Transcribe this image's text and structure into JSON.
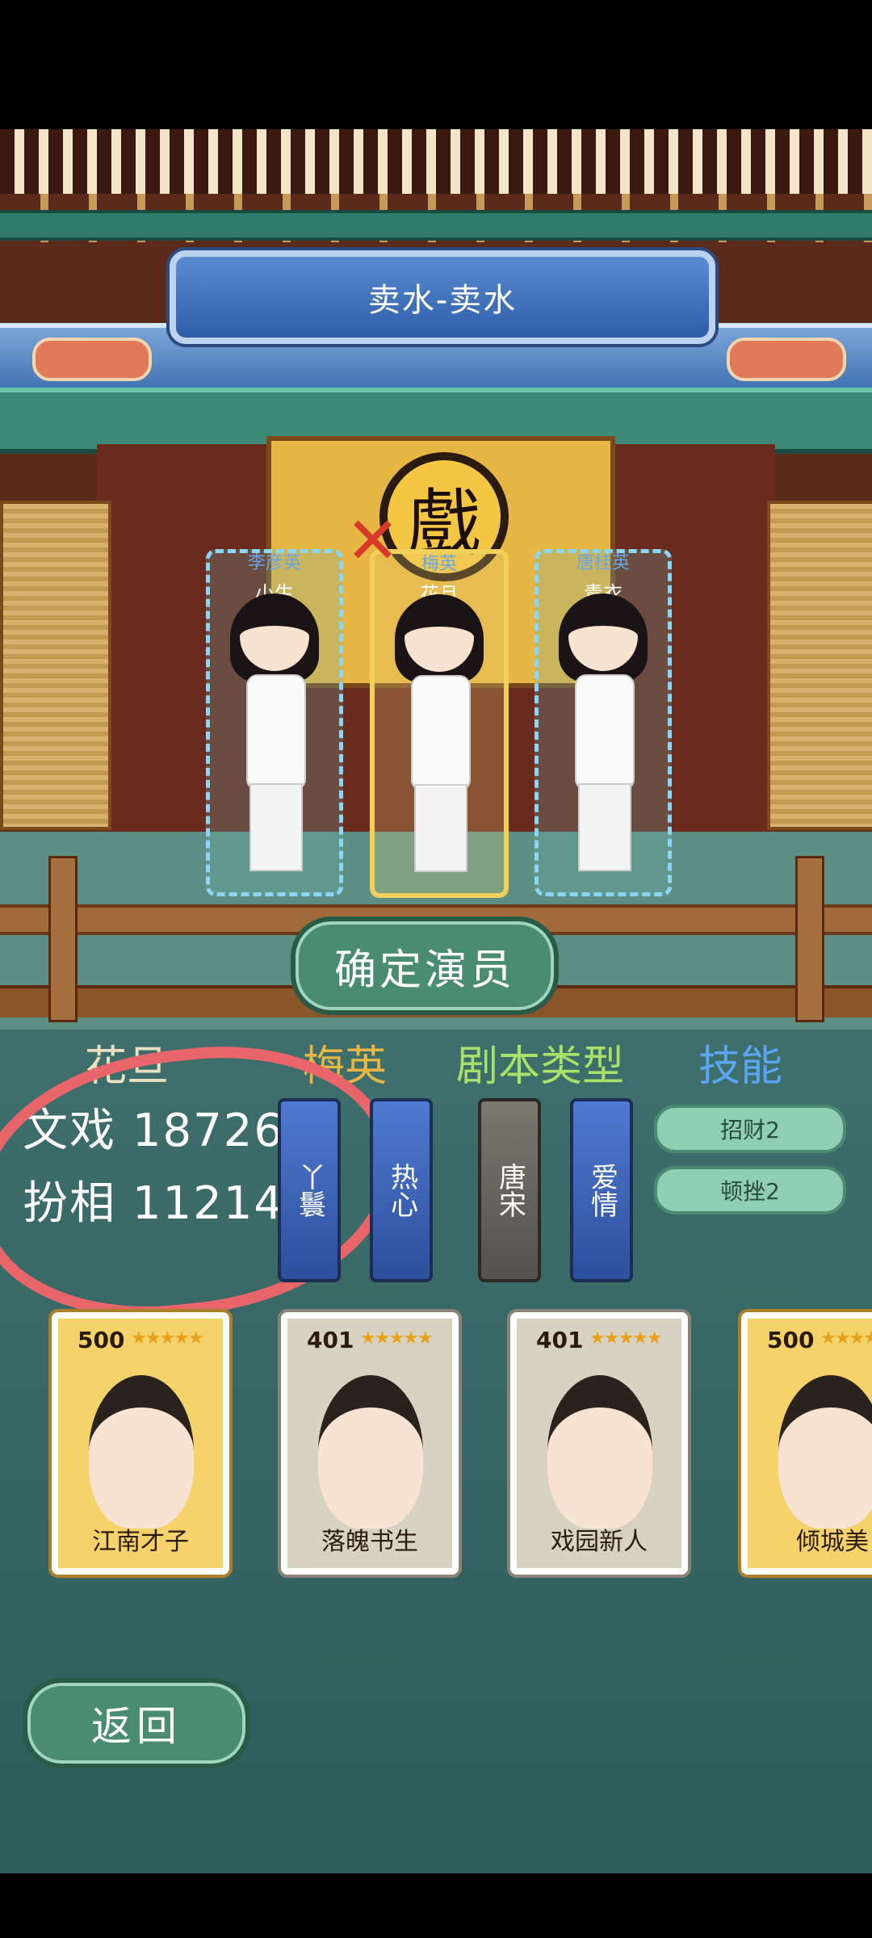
{
  "play_title": "卖水-卖水",
  "stage_emblem": "戲",
  "actors": [
    {
      "name": "李彦英",
      "role": "小生",
      "selected": false
    },
    {
      "name": "梅英",
      "role": "花旦",
      "selected": true
    },
    {
      "name": "唐桂英",
      "role": "青衣",
      "selected": false
    }
  ],
  "confirm_label": "确定演员",
  "role_header": "花旦",
  "actor_header": "梅英",
  "script_type_header": "剧本类型",
  "skills_header": "技能",
  "stats": [
    {
      "label": "文戏",
      "value": "18726"
    },
    {
      "label": "扮相",
      "value": "11214"
    }
  ],
  "actor_tags": [
    "丫鬟",
    "热心"
  ],
  "script_tags": [
    "唐宋",
    "爱情"
  ],
  "skills": [
    "招财2",
    "顿挫2"
  ],
  "cards": [
    {
      "level": "500",
      "stars": "★★★★★",
      "name": "江南才子",
      "rarity": "gold"
    },
    {
      "level": "401",
      "stars": "★★★★★",
      "name": "落魄书生",
      "rarity": "silver"
    },
    {
      "level": "401",
      "stars": "★★★★★",
      "name": "戏园新人",
      "rarity": "silver"
    },
    {
      "level": "500",
      "stars": "★★★★★",
      "name": "倾城美",
      "rarity": "gold"
    }
  ],
  "back_label": "返回",
  "colors": {
    "highlight": "#f0d05a",
    "header_gold": "#e7b645",
    "header_green": "#a8e06a",
    "header_blue": "#5aa6f0",
    "circle": "#e8666a"
  }
}
